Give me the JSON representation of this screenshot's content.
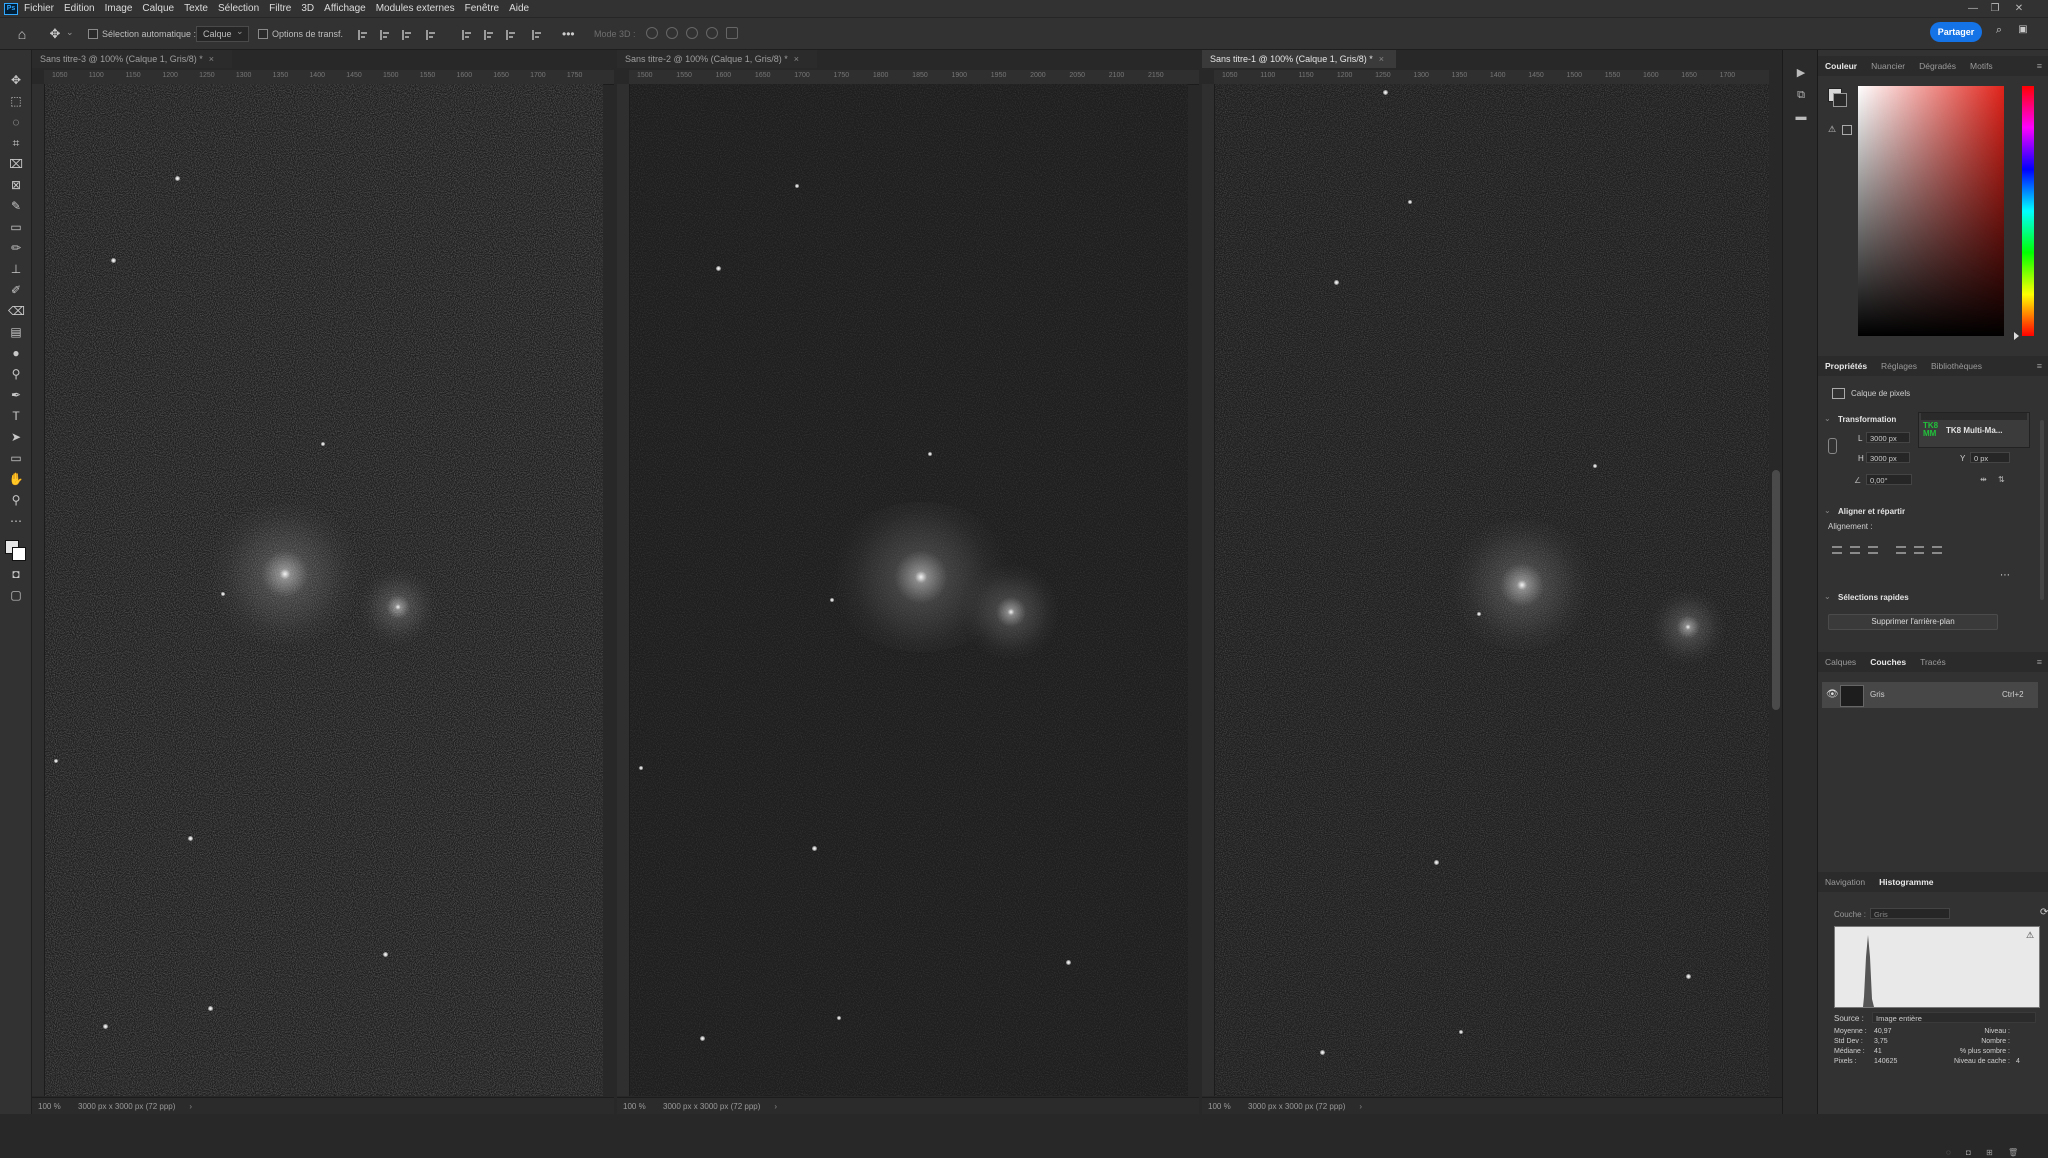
{
  "menu": {
    "logo": "Ps",
    "items": [
      "Fichier",
      "Edition",
      "Image",
      "Calque",
      "Texte",
      "Sélection",
      "Filtre",
      "3D",
      "Affichage",
      "Modules externes",
      "Fenêtre",
      "Aide"
    ]
  },
  "options": {
    "auto_select_label": "Sélection automatique :",
    "auto_select_value": "Calque",
    "transform_label": "Options de transf.",
    "more": "•••",
    "mode3d_label": "Mode 3D :",
    "share_label": "Partager"
  },
  "documents": [
    {
      "title": "Sans titre-3 @ 100% (Calque 1, Gris/8) *",
      "zoom": "100 %",
      "info": "3000 px x 3000 px (72 ppp)",
      "ruler": [
        "1050",
        "1100",
        "1150",
        "1200",
        "1250",
        "1300",
        "1350",
        "1400",
        "1450",
        "1500",
        "1550",
        "1600",
        "1650",
        "1700",
        "1750"
      ]
    },
    {
      "title": "Sans titre-2 @ 100% (Calque 1, Gris/8) *",
      "zoom": "100 %",
      "info": "3000 px x 3000 px (72 ppp)",
      "ruler": [
        "1500",
        "1550",
        "1600",
        "1650",
        "1700",
        "1750",
        "1800",
        "1850",
        "1900",
        "1950",
        "2000",
        "2050",
        "2100",
        "2150"
      ]
    },
    {
      "title": "Sans titre-1 @ 100% (Calque 1, Gris/8) *",
      "zoom": "100 %",
      "info": "3000 px x 3000 px (72 ppp)",
      "ruler": [
        "1050",
        "1100",
        "1150",
        "1200",
        "1250",
        "1300",
        "1350",
        "1400",
        "1450",
        "1500",
        "1550",
        "1600",
        "1650",
        "1700"
      ]
    }
  ],
  "panels": {
    "color_tabs": [
      "Couleur",
      "Nuancier",
      "Dégradés",
      "Motifs"
    ],
    "props_tabs": [
      "Propriétés",
      "Réglages",
      "Bibliothèques"
    ],
    "pixel_layer": "Calque de pixels",
    "transform": {
      "title": "Transformation",
      "w_label": "L",
      "w_value": "3000 px",
      "h_label": "H",
      "h_value": "3000 px",
      "y_label": "Y",
      "y_value": "0 px",
      "angle_value": "0,00°"
    },
    "plugin_label": "TK8 Multi-Ma...",
    "plugin_logo": "TK8\nMM",
    "align": {
      "title": "Aligner et répartir",
      "label": "Alignement :"
    },
    "quick": {
      "title": "Sélections rapides",
      "button": "Supprimer l'arrière-plan"
    },
    "layer_tabs": [
      "Calques",
      "Couches",
      "Tracés"
    ],
    "channel": {
      "name": "Gris",
      "shortcut": "Ctrl+2"
    },
    "nav_tabs": [
      "Navigation",
      "Histogramme"
    ],
    "histogram": {
      "channel_label": "Couche :",
      "channel_value": "Gris",
      "source_label": "Source :",
      "source_value": "Image entière",
      "stats_left": [
        {
          "label": "Moyenne :",
          "value": "40,97"
        },
        {
          "label": "Std Dev :",
          "value": "3,75"
        },
        {
          "label": "Médiane :",
          "value": "41"
        },
        {
          "label": "Pixels :",
          "value": "140625"
        }
      ],
      "stats_right": [
        {
          "label": "Niveau :",
          "value": ""
        },
        {
          "label": "Nombre :",
          "value": ""
        },
        {
          "label": "% plus sombre :",
          "value": ""
        },
        {
          "label": "Niveau de cache :",
          "value": "4"
        }
      ]
    }
  },
  "colors": {
    "accent": "#1473e6",
    "panel": "#323232",
    "bg": "#282828"
  }
}
